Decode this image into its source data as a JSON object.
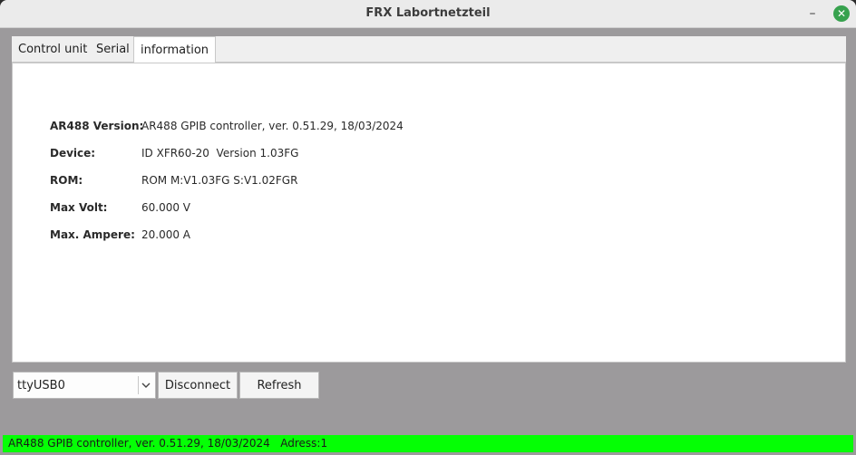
{
  "window": {
    "title": "FRX Labortnetzteil",
    "minimize_glyph": "–",
    "close_glyph": "✕"
  },
  "tabs": [
    {
      "label": "Control unit",
      "active": false
    },
    {
      "label": "Serial",
      "active": false
    },
    {
      "label": "information",
      "active": true
    }
  ],
  "info": {
    "rows": [
      {
        "label": "AR488 Version:",
        "value": "AR488 GPIB controller, ver. 0.51.29, 18/03/2024"
      },
      {
        "label": "Device:",
        "value": "ID XFR60-20  Version 1.03FG"
      },
      {
        "label": "ROM:",
        "value": "ROM M:V1.03FG S:V1.02FGR"
      },
      {
        "label": "Max Volt:",
        "value": "60.000 V"
      },
      {
        "label": "Max. Ampere:",
        "value": "20.000 A"
      }
    ]
  },
  "controls": {
    "port_selected": "ttyUSB0",
    "disconnect_label": "Disconnect",
    "refresh_label": "Refresh"
  },
  "status": {
    "text": "AR488 GPIB controller, ver. 0.51.29, 18/03/2024   Adress:1",
    "color": "#05ff05"
  },
  "colors": {
    "close_button": "#37a24e",
    "window_background": "#9c9a9c"
  }
}
